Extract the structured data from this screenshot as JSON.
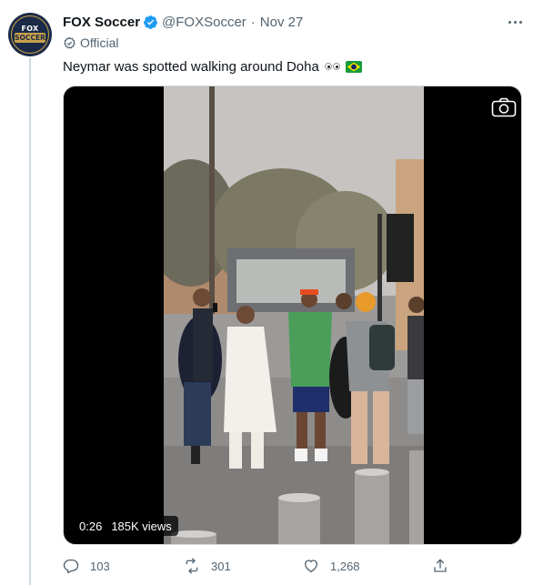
{
  "account": {
    "name": "FOX Soccer",
    "handle": "@FOXSoccer",
    "separator": "·",
    "date": "Nov 27",
    "label": "Official",
    "avatar_logo_top": "FOX",
    "avatar_logo_bar": "SOCCER"
  },
  "tweet": {
    "text": "Neymar was spotted walking around Doha"
  },
  "media": {
    "duration": "0:26",
    "views": "185K views"
  },
  "actions": {
    "replies": "103",
    "retweets": "301",
    "likes": "1,268"
  },
  "colors": {
    "verified_blue": "#1d9bf0",
    "secondary_text": "#536471",
    "thread_line": "#cfd9de"
  },
  "icons": [
    "verified-badge-icon",
    "official-badge-icon",
    "eyes-emoji-icon",
    "brazil-flag-icon",
    "camera-icon",
    "more-icon",
    "reply-icon",
    "retweet-icon",
    "like-icon",
    "share-icon"
  ]
}
